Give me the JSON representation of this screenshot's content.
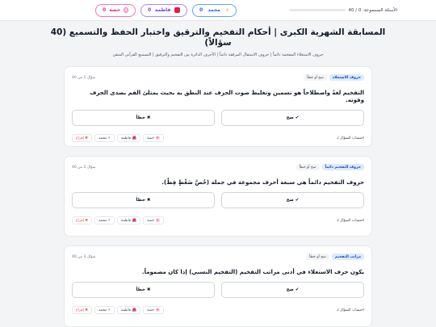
{
  "topbar": {
    "progress_label": "الأسئلة المسموعة: 0 / 40",
    "players": [
      {
        "name": "حصة",
        "score": "0",
        "color": "#db2777",
        "icon": "flower-icon"
      },
      {
        "name": "فاطمة",
        "score": "0",
        "color": "#7c3aed",
        "icon": "blossom-icon"
      },
      {
        "name": "محمد",
        "score": "0",
        "color": "#2563eb",
        "icon": "bolt-icon"
      }
    ]
  },
  "header": {
    "title": "المسابقة الشهرية الكبرى | أحكام التفخيم والترقيق واختبار الحفظ والتسميع (40 سؤالاً)",
    "subtitle": "حروف الاستعلاء المفخمة دائماً | حروف الاستفال المرققة دائماً | الأحرف الدائرة بين التفخيم والترقيق | التسميع القرآني المتقن"
  },
  "common": {
    "true_label": "✔ صح",
    "false_label": "✖ خطأ",
    "assign_label": "احتساب السؤال لـ",
    "p1": "🌸 حصة",
    "p2": "🌺 فاطمة",
    "p3": "⚡ محمد",
    "clear": "✖ إفراغ"
  },
  "questions": [
    {
      "category": "حروف الاستعلاء",
      "type": "صح أو خطأ",
      "number": "سؤال 1 من 40",
      "text": "التفخيم لغةً واصطلاحاً هو تسمين وتغليظ صوت الحرف عند النطق به بحيث يمتلئ الفم بصدى الحرف وقوته."
    },
    {
      "category": "حروف التفخيم دائماً",
      "type": "صح أو خطأ",
      "number": "سؤال 2 من 40",
      "text": "حروف التفخيم دائماً هي سبعة أحرف مجموعة في جملة (خُصَّ ضَغْطٍ قِظْ)."
    },
    {
      "category": "مراتب التفخيم",
      "type": "صح أو خطأ",
      "number": "سؤال 3 من 40",
      "text": "يكون حرف الاستعلاء في أدنى مراتب التفخيم (التفخيم النسبي) إذا كان مضموماً."
    }
  ]
}
